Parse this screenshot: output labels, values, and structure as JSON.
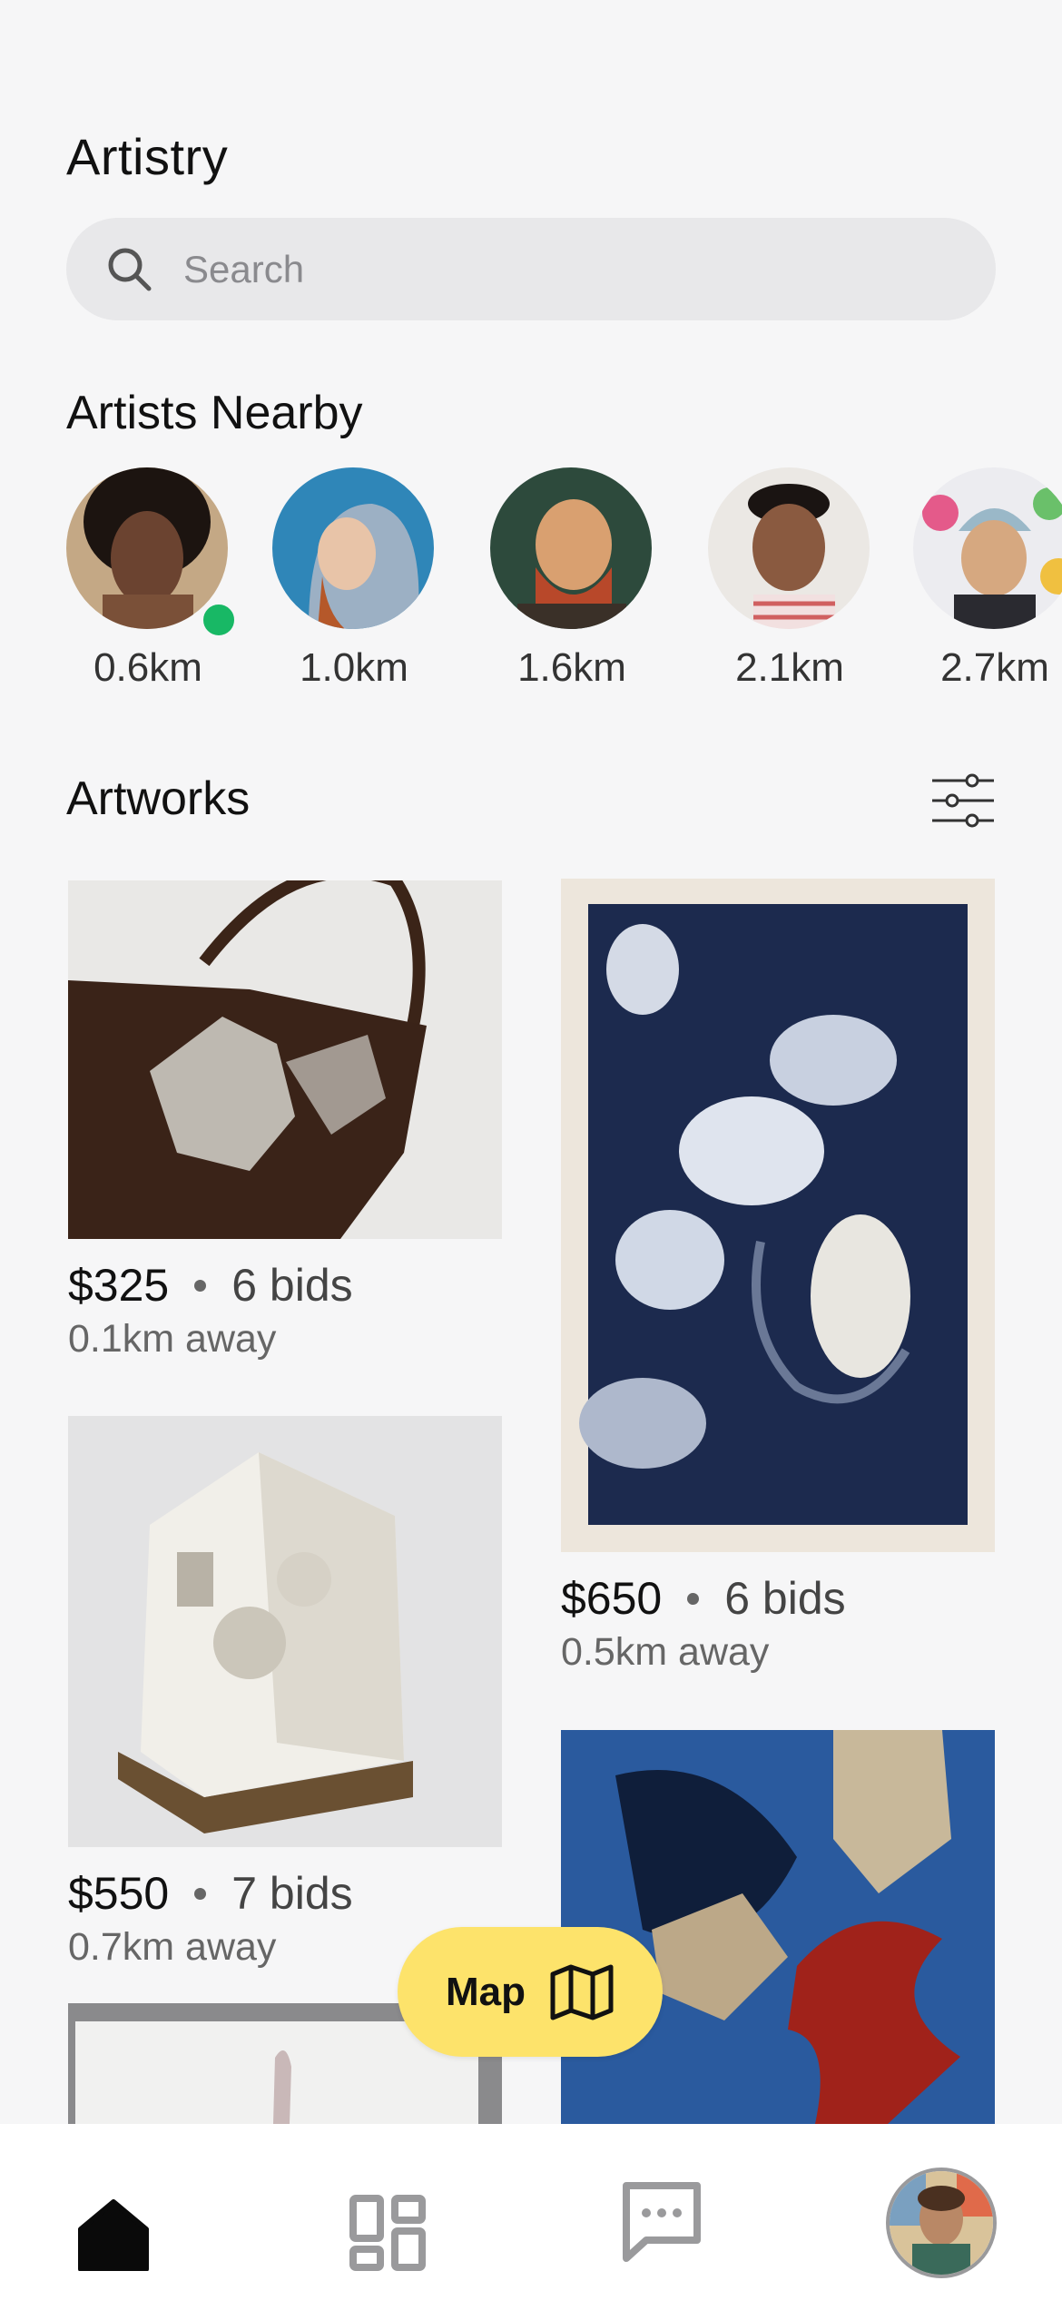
{
  "app": {
    "title": "Artistry"
  },
  "search": {
    "placeholder": "Search"
  },
  "artists_nearby": {
    "title": "Artists Nearby",
    "artists": [
      {
        "distance": "0.6km",
        "online": true
      },
      {
        "distance": "1.0km",
        "online": false
      },
      {
        "distance": "1.6km",
        "online": false
      },
      {
        "distance": "2.1km",
        "online": false
      },
      {
        "distance": "2.7km",
        "online": false
      }
    ]
  },
  "artworks": {
    "title": "Artworks",
    "items": [
      {
        "price": "$325",
        "bids": "6 bids",
        "distance": "0.1km away"
      },
      {
        "price": "$650",
        "bids": "6 bids",
        "distance": "0.5km away"
      },
      {
        "price": "$550",
        "bids": "7 bids",
        "distance": "0.7km away"
      }
    ]
  },
  "map_button": {
    "label": "Map"
  },
  "colors": {
    "background": "#f6f6f7",
    "accent": "#fde36b",
    "online": "#18b865"
  },
  "tabbar": {
    "tabs": [
      "home-icon",
      "grid-icon",
      "chat-icon",
      "profile-avatar"
    ]
  }
}
